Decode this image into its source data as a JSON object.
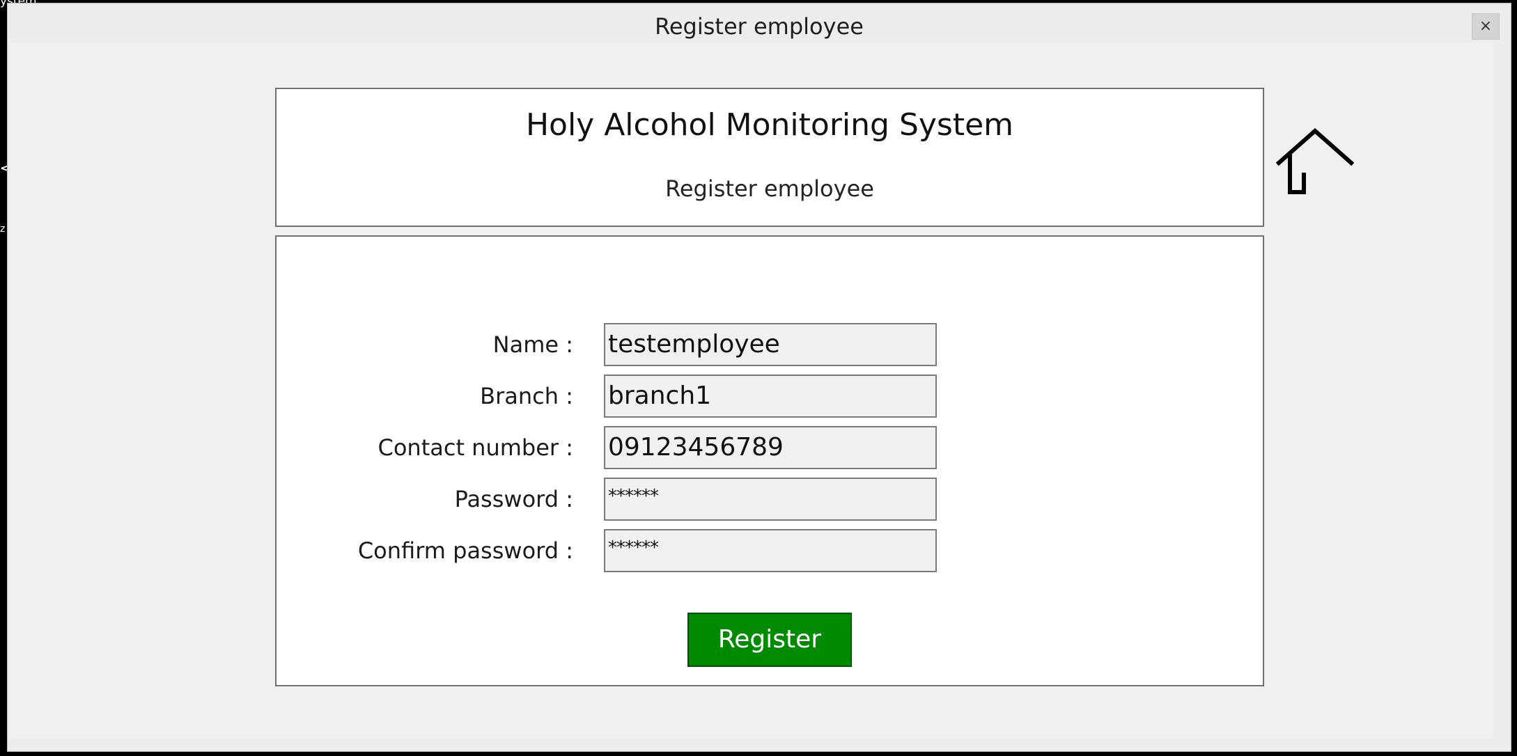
{
  "background_fragments": {
    "top_left": "ystem",
    "left_mid_1": "<",
    "left_mid_2": "z"
  },
  "window": {
    "title": "Register employee",
    "close_label": "×"
  },
  "header": {
    "app_title": "Holy Alcohol Monitoring System",
    "page_subtitle": "Register employee"
  },
  "home_button": {
    "icon": "home-icon"
  },
  "form": {
    "fields": [
      {
        "label": "Name :",
        "value": "testemployee"
      },
      {
        "label": "Branch :",
        "value": "branch1"
      },
      {
        "label": "Contact number :",
        "value": "09123456789"
      },
      {
        "label": "Password :",
        "value": "******"
      },
      {
        "label": "Confirm password :",
        "value": "******"
      }
    ],
    "submit_label": "Register"
  },
  "colors": {
    "register_button": "#008a00",
    "panel_border": "#6f6f6f",
    "window_background": "#f0f0f0"
  }
}
